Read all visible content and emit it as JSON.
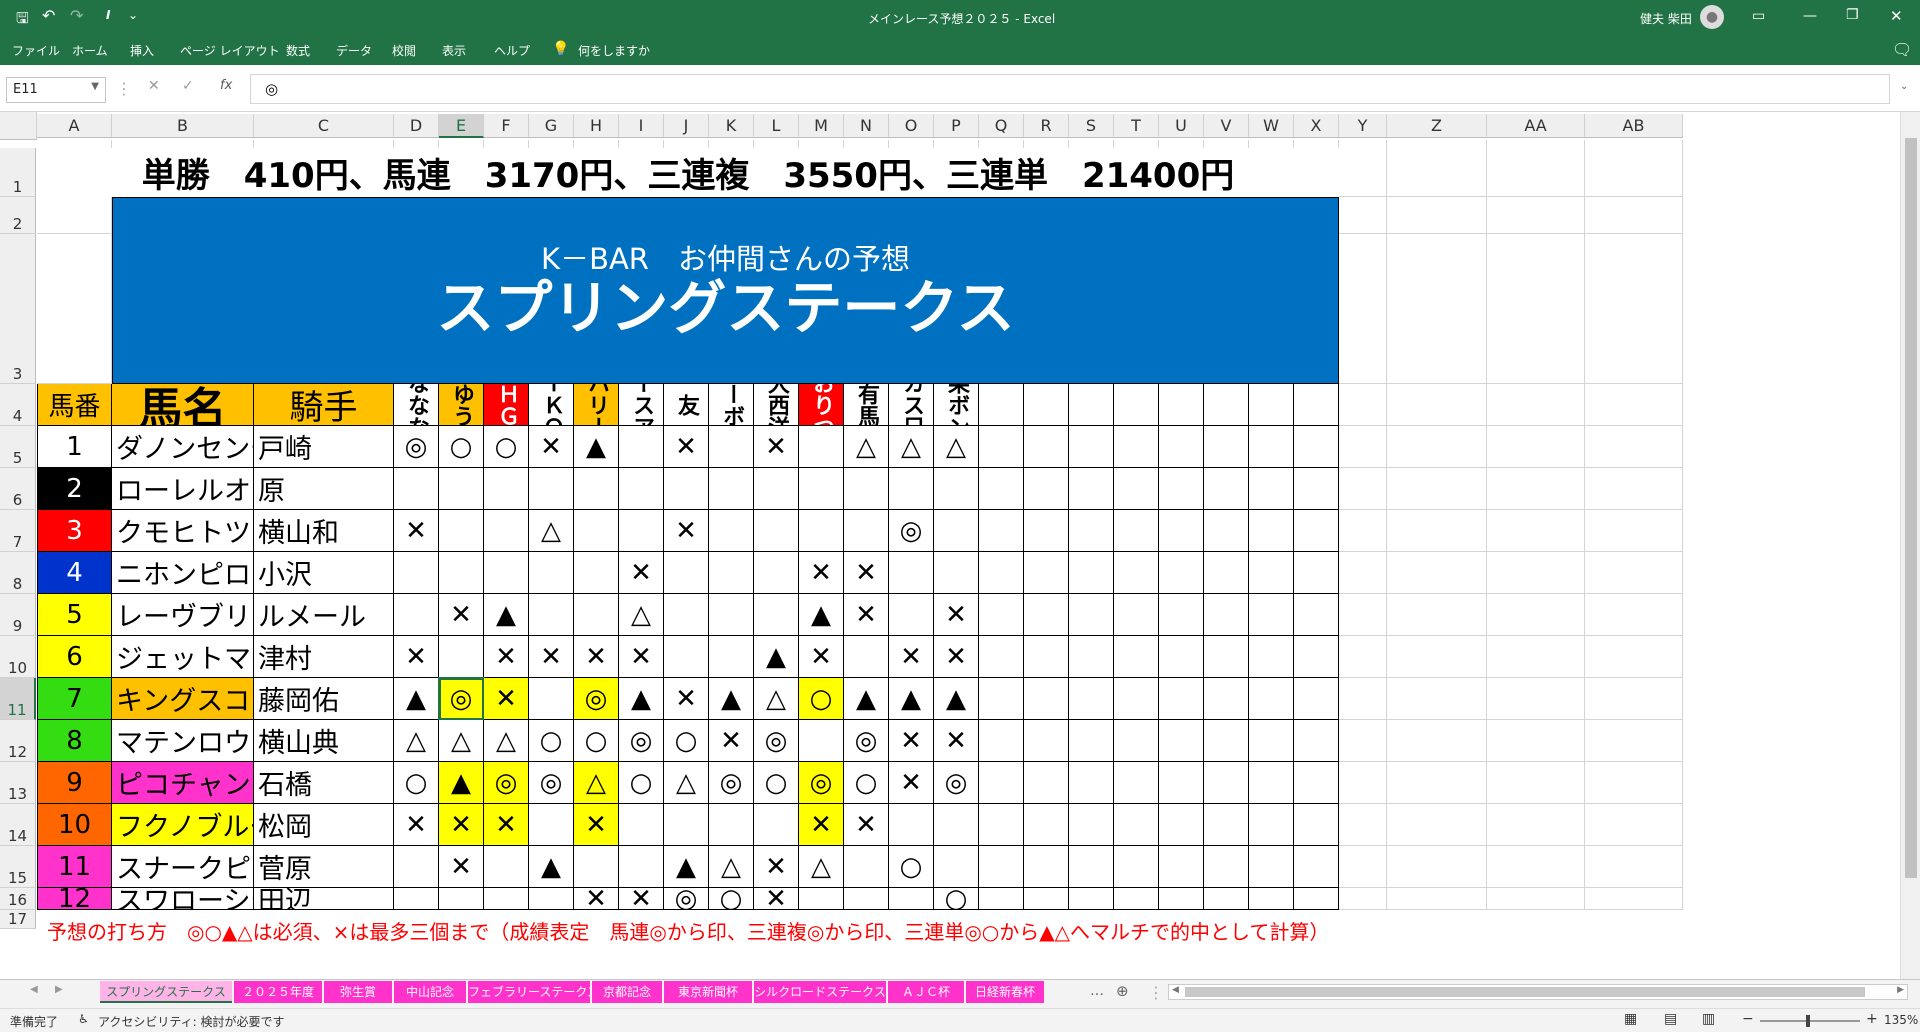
{
  "titlebar": {
    "doc_title": "メインレース予想２０２５ - Excel",
    "user": "健夫 柴田"
  },
  "ribbon": {
    "tabs": [
      "ファイル",
      "ホーム",
      "挿入",
      "ページ レイアウト",
      "数式",
      "データ",
      "校閲",
      "表示",
      "ヘルプ"
    ],
    "tell_me": "何をしますか"
  },
  "formula": {
    "name_box": "E11",
    "cancel": "✕",
    "enter": "✓",
    "fx": "fx",
    "content": "◎"
  },
  "columns": [
    "A",
    "B",
    "C",
    "D",
    "E",
    "F",
    "G",
    "H",
    "I",
    "J",
    "K",
    "L",
    "M",
    "N",
    "O",
    "P",
    "Q",
    "R",
    "S",
    "T",
    "U",
    "V",
    "W",
    "X",
    "Y",
    "Z",
    "AA",
    "AB"
  ],
  "rows": [
    "1",
    "2",
    "3",
    "4",
    "5",
    "6",
    "7",
    "8",
    "9",
    "10",
    "11",
    "12",
    "13",
    "14",
    "15",
    "16",
    "17"
  ],
  "sheet": {
    "payout": "単勝　410円、馬連　3170円、三連複　3550円、三連単　21400円",
    "banner_sub": "K－BAR　お仲間さんの予想",
    "banner_title": "スプリングステークス",
    "hdr_num": "馬番",
    "hdr_name": "馬名",
    "hdr_jockey": "騎手",
    "forecasters": [
      {
        "name": "ななな",
        "bg": "#ffffff",
        "fg": "#000000"
      },
      {
        "name": "ゆう",
        "bg": "#ffc000",
        "fg": "#000000"
      },
      {
        "name": "ＨＧ",
        "bg": "#ff0000",
        "fg": "#ffffff"
      },
      {
        "name": "ＴＫＯ",
        "bg": "#ffffff",
        "fg": "#000000"
      },
      {
        "name": "ハリー",
        "bg": "#ffc000",
        "fg": "#000000"
      },
      {
        "name": "レースアナ",
        "bg": "#ffffff",
        "fg": "#000000"
      },
      {
        "name": "友",
        "bg": "#ffffff",
        "fg": "#000000"
      },
      {
        "name": "バーボン",
        "bg": "#ffffff",
        "fg": "#000000"
      },
      {
        "name": "大西洋",
        "bg": "#ffffff",
        "fg": "#000000"
      },
      {
        "name": "おりつ",
        "bg": "#ff0000",
        "fg": "#ffffff"
      },
      {
        "name": "有馬",
        "bg": "#ffffff",
        "fg": "#000000"
      },
      {
        "name": "カス兄",
        "bg": "#ffffff",
        "fg": "#000000"
      },
      {
        "name": "柴ボン",
        "bg": "#ffffff",
        "fg": "#000000"
      }
    ],
    "horses": [
      {
        "num": "1",
        "num_bg": "#ffffff",
        "num_fg": "#000000",
        "name": "ダノンセンチュリー",
        "name_bg": "#ffffff",
        "jockey": "戸崎",
        "marks": [
          "◎",
          "○",
          "○",
          "✕",
          "▲",
          "",
          "✕",
          "",
          "✕",
          "",
          "△",
          "△",
          "△"
        ],
        "mark_bg": [
          "",
          "",
          "",
          "",
          "",
          "",
          "",
          "",
          "",
          "",
          "",
          "",
          ""
        ]
      },
      {
        "num": "2",
        "num_bg": "#000000",
        "num_fg": "#ffffff",
        "name": "ローレルオーブ",
        "name_bg": "#ffffff",
        "jockey": "原",
        "marks": [
          "",
          "",
          "",
          "",
          "",
          "",
          "",
          "",
          "",
          "",
          "",
          "",
          ""
        ],
        "mark_bg": [
          "",
          "",
          "",
          "",
          "",
          "",
          "",
          "",
          "",
          "",
          "",
          "",
          ""
        ]
      },
      {
        "num": "3",
        "num_bg": "#ff0000",
        "num_fg": "#ffffff",
        "name": "クモヒトツナイ",
        "name_bg": "#ffffff",
        "jockey": "横山和",
        "marks": [
          "✕",
          "",
          "",
          "△",
          "",
          "",
          "✕",
          "",
          "",
          "",
          "",
          "◎",
          ""
        ],
        "mark_bg": [
          "",
          "",
          "",
          "",
          "",
          "",
          "",
          "",
          "",
          "",
          "",
          "",
          ""
        ]
      },
      {
        "num": "4",
        "num_bg": "#0033cc",
        "num_fg": "#ffffff",
        "name": "ニホンピロデヴィン",
        "name_bg": "#ffffff",
        "jockey": "小沢",
        "marks": [
          "",
          "",
          "",
          "",
          "",
          "✕",
          "",
          "",
          "",
          "✕",
          "✕",
          "",
          ""
        ],
        "mark_bg": [
          "",
          "",
          "",
          "",
          "",
          "",
          "",
          "",
          "",
          "",
          "",
          "",
          ""
        ]
      },
      {
        "num": "5",
        "num_bg": "#ffff00",
        "num_fg": "#000000",
        "name": "レーヴブリリアント",
        "name_bg": "#ffffff",
        "jockey": "ルメール",
        "marks": [
          "",
          "✕",
          "▲",
          "",
          "",
          "△",
          "",
          "",
          "",
          "▲",
          "✕",
          "",
          "✕"
        ],
        "mark_bg": [
          "",
          "",
          "",
          "",
          "",
          "",
          "",
          "",
          "",
          "",
          "",
          "",
          ""
        ]
      },
      {
        "num": "6",
        "num_bg": "#ffff00",
        "num_fg": "#000000",
        "name": "ジェットマグナム",
        "name_bg": "#ffffff",
        "jockey": "津村",
        "marks": [
          "✕",
          "",
          "✕",
          "✕",
          "✕",
          "✕",
          "",
          "",
          "▲",
          "✕",
          "",
          "✕",
          "✕"
        ],
        "mark_bg": [
          "",
          "",
          "",
          "",
          "",
          "",
          "",
          "",
          "",
          "",
          "",
          "",
          ""
        ]
      },
      {
        "num": "7",
        "num_bg": "#33dd11",
        "num_fg": "#000000",
        "name": "キングスコール",
        "name_bg": "#ffc000",
        "jockey": "藤岡佑",
        "marks": [
          "▲",
          "◎",
          "✕",
          "",
          "◎",
          "▲",
          "✕",
          "▲",
          "△",
          "○",
          "▲",
          "▲",
          "▲"
        ],
        "mark_bg": [
          "",
          "#ffff00",
          "#ffff00",
          "",
          "#ffff00",
          "",
          "",
          "",
          "",
          "#ffff00",
          "",
          "",
          ""
        ]
      },
      {
        "num": "8",
        "num_bg": "#33dd11",
        "num_fg": "#000000",
        "name": "マテンロウバローズ",
        "name_bg": "#ffffff",
        "jockey": "横山典",
        "marks": [
          "△",
          "△",
          "△",
          "○",
          "○",
          "◎",
          "○",
          "✕",
          "◎",
          "",
          "◎",
          "✕",
          "✕"
        ],
        "mark_bg": [
          "",
          "",
          "",
          "",
          "",
          "",
          "",
          "",
          "",
          "",
          "",
          "",
          ""
        ]
      },
      {
        "num": "9",
        "num_bg": "#ff6600",
        "num_fg": "#000000",
        "name": "ピコチャンブラック",
        "name_bg": "#ff33cc",
        "jockey": "石橋",
        "marks": [
          "○",
          "▲",
          "◎",
          "◎",
          "△",
          "○",
          "△",
          "◎",
          "○",
          "◎",
          "○",
          "✕",
          "◎"
        ],
        "mark_bg": [
          "",
          "#ffff00",
          "#ffff00",
          "",
          "#ffff00",
          "",
          "",
          "",
          "",
          "#ffff00",
          "",
          "",
          ""
        ]
      },
      {
        "num": "10",
        "num_bg": "#ff6600",
        "num_fg": "#000000",
        "name": "フクノブルーレイク",
        "name_bg": "#ffff00",
        "jockey": "松岡",
        "marks": [
          "✕",
          "✕",
          "✕",
          "",
          "✕",
          "",
          "",
          "",
          "",
          "✕",
          "✕",
          "",
          ""
        ],
        "mark_bg": [
          "",
          "#ffff00",
          "#ffff00",
          "",
          "#ffff00",
          "",
          "",
          "",
          "",
          "#ffff00",
          "",
          "",
          ""
        ]
      },
      {
        "num": "11",
        "num_bg": "#ff33cc",
        "num_fg": "#000000",
        "name": "スナークピカソ",
        "name_bg": "#ffffff",
        "jockey": "菅原",
        "marks": [
          "",
          "✕",
          "",
          "▲",
          "",
          "",
          "▲",
          "△",
          "✕",
          "△",
          "",
          "○",
          ""
        ],
        "mark_bg": [
          "",
          "",
          "",
          "",
          "",
          "",
          "",
          "",
          "",
          "",
          "",
          "",
          ""
        ]
      },
      {
        "num": "12",
        "num_bg": "#ff33cc",
        "num_fg": "#000000",
        "name": "スワローシチー",
        "name_bg": "#ffffff",
        "jockey": "田辺",
        "marks": [
          "",
          "",
          "",
          "",
          "✕",
          "✕",
          "◎",
          "○",
          "✕",
          "",
          "",
          "",
          "○"
        ],
        "mark_bg": [
          "",
          "",
          "",
          "",
          "",
          "",
          "",
          "",
          "",
          "",
          "",
          "",
          ""
        ]
      }
    ],
    "footnote": "予想の打ち方　◎○▲△は必須、×は最多三個まで（成績表定　馬連◎から印、三連複◎から印、三連単◎○から▲△へマルチで的中として計算）"
  },
  "sheet_tabs": [
    {
      "label": "スプリングステークス",
      "bg": "#ff66cc",
      "fg": "#000000",
      "active": true
    },
    {
      "label": "２０２５年度",
      "bg": "#ff33cc",
      "fg": "#ffffff",
      "active": false
    },
    {
      "label": "弥生賞",
      "bg": "#ff33cc",
      "fg": "#ffffff",
      "active": false
    },
    {
      "label": "中山記念",
      "bg": "#ff33cc",
      "fg": "#ffffff",
      "active": false
    },
    {
      "label": "フェブラリーステークス",
      "bg": "#ff33cc",
      "fg": "#ffffff",
      "active": false
    },
    {
      "label": "京都記念",
      "bg": "#ff33cc",
      "fg": "#ffffff",
      "active": false
    },
    {
      "label": "東京新聞杯",
      "bg": "#ff33cc",
      "fg": "#ffffff",
      "active": false
    },
    {
      "label": "シルクロードステークス",
      "bg": "#ff33cc",
      "fg": "#ffffff",
      "active": false
    },
    {
      "label": "ＡＪＣ杯",
      "bg": "#ff33cc",
      "fg": "#ffffff",
      "active": false
    },
    {
      "label": "日経新春杯",
      "bg": "#ff33cc",
      "fg": "#ffffff",
      "active": false
    }
  ],
  "status": {
    "ready": "準備完了",
    "accessibility": "アクセシビリティ: 検討が必要です",
    "zoom": "135%"
  },
  "colors": {
    "excel_green": "#217346",
    "banner_blue": "#0070c0"
  }
}
